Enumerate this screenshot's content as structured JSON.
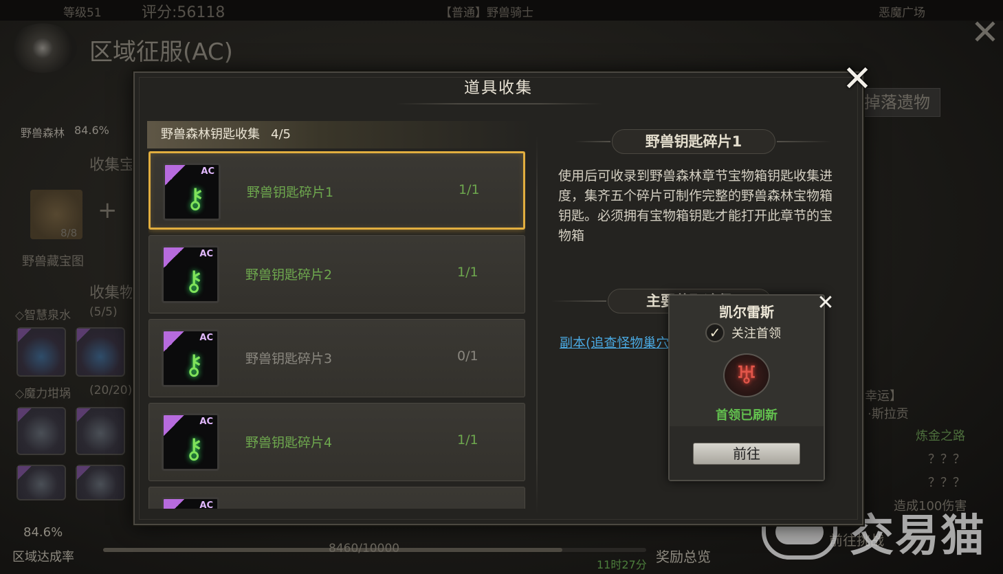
{
  "background": {
    "topbar": {
      "level": "等级51",
      "score": "评分:56118",
      "quest": "【普通】野兽骑士",
      "location": "恶魔广场"
    },
    "region_title": "区域征服(AC)",
    "right_tab": "掉落遗物",
    "forest_progress": {
      "name": "野兽森林",
      "percent": "84.6%"
    },
    "collect_treasure_label": "收集宝",
    "treasure_map": {
      "count": "8/8",
      "name": "野兽藏宝图"
    },
    "collect_items_label": "收集物",
    "wisdom_spring": {
      "name": "◇智慧泉水",
      "count": "(5/5)"
    },
    "magic_crucible": {
      "name": "◇魔力坩埚",
      "count": "(20/20)"
    },
    "right_labels": {
      "luck": "幸运】",
      "silacon": "·斯拉贡",
      "alchemy": "炼金之路",
      "unknown1": "？？？",
      "unknown2": "？？？",
      "damage": "造成100伤害"
    },
    "bottom": {
      "region_rate_value": "84.6%",
      "region_rate_label": "区域达成率",
      "progress_text": "8460/10000",
      "progress_fraction": 0.846,
      "timer": "11时27分",
      "rewards": "奖励总览",
      "challenge": "前往挑战"
    },
    "watermark": "交易猫"
  },
  "modal": {
    "title": "道具收集",
    "close_icon": "close-icon",
    "group": {
      "name": "野兽森林钥匙收集",
      "count": "4/5"
    },
    "items": [
      {
        "name": "野兽钥匙碎片1",
        "qty": "1/1",
        "badge": "AC",
        "selected": true,
        "complete": true
      },
      {
        "name": "野兽钥匙碎片2",
        "qty": "1/1",
        "badge": "AC",
        "selected": false,
        "complete": true
      },
      {
        "name": "野兽钥匙碎片3",
        "qty": "0/1",
        "badge": "AC",
        "selected": false,
        "complete": false
      },
      {
        "name": "野兽钥匙碎片4",
        "qty": "1/1",
        "badge": "AC",
        "selected": false,
        "complete": true
      },
      {
        "name": "",
        "qty": "",
        "badge": "AC",
        "selected": false,
        "complete": true
      }
    ],
    "detail": {
      "title": "野兽钥匙碎片1",
      "description": "使用后可收录到野兽森林章节宝物箱钥匙收集进度，集齐五个碎片可制作完整的野兽森林宝物箱钥匙。必须拥有宝物箱钥匙才能打开此章节的宝物箱",
      "source_title": "主要获取途径",
      "source_link": "副本(追查怪物巢穴)"
    },
    "boss_popup": {
      "name": "凯尔雷斯",
      "follow_label": "关注首领",
      "follow_checked": true,
      "status": "首领已刷新",
      "button": "前往"
    }
  },
  "colors": {
    "selected_border": "#e2ae3f",
    "complete_text": "#6ea84e",
    "incomplete_text": "#8a877f",
    "link": "#4aa8e0",
    "boss_status": "#63c24f"
  }
}
